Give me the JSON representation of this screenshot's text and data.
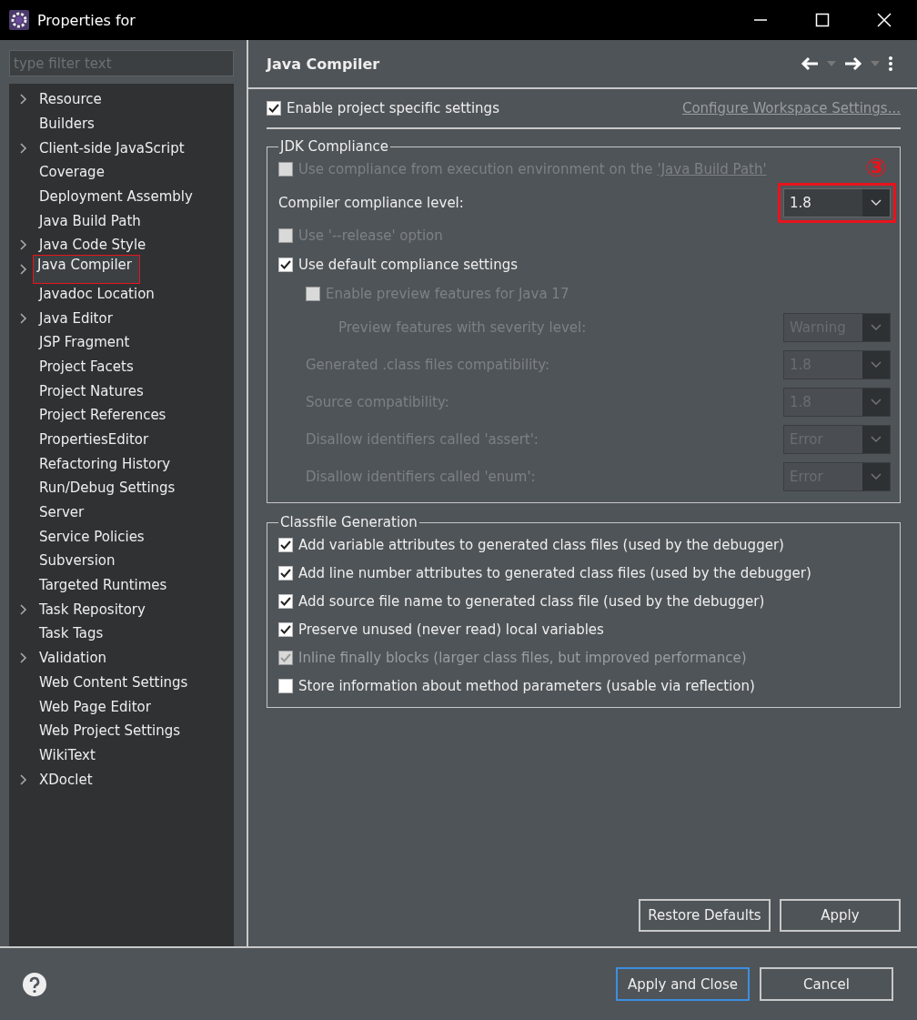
{
  "window": {
    "title": "Properties for"
  },
  "filter": {
    "placeholder": "type filter text"
  },
  "tree": [
    {
      "label": "Resource",
      "expandable": true,
      "selected": false
    },
    {
      "label": "Builders",
      "expandable": false,
      "selected": false
    },
    {
      "label": "Client-side JavaScript",
      "expandable": true,
      "selected": false
    },
    {
      "label": "Coverage",
      "expandable": false,
      "selected": false
    },
    {
      "label": "Deployment Assembly",
      "expandable": false,
      "selected": false
    },
    {
      "label": "Java Build Path",
      "expandable": false,
      "selected": false
    },
    {
      "label": "Java Code Style",
      "expandable": true,
      "selected": false
    },
    {
      "label": "Java Compiler",
      "expandable": true,
      "selected": true
    },
    {
      "label": "Javadoc Location",
      "expandable": false,
      "selected": false
    },
    {
      "label": "Java Editor",
      "expandable": true,
      "selected": false
    },
    {
      "label": "JSP Fragment",
      "expandable": false,
      "selected": false
    },
    {
      "label": "Project Facets",
      "expandable": false,
      "selected": false
    },
    {
      "label": "Project Natures",
      "expandable": false,
      "selected": false
    },
    {
      "label": "Project References",
      "expandable": false,
      "selected": false
    },
    {
      "label": "PropertiesEditor",
      "expandable": false,
      "selected": false
    },
    {
      "label": "Refactoring History",
      "expandable": false,
      "selected": false
    },
    {
      "label": "Run/Debug Settings",
      "expandable": false,
      "selected": false
    },
    {
      "label": "Server",
      "expandable": false,
      "selected": false
    },
    {
      "label": "Service Policies",
      "expandable": false,
      "selected": false
    },
    {
      "label": "Subversion",
      "expandable": false,
      "selected": false
    },
    {
      "label": "Targeted Runtimes",
      "expandable": false,
      "selected": false
    },
    {
      "label": "Task Repository",
      "expandable": true,
      "selected": false
    },
    {
      "label": "Task Tags",
      "expandable": false,
      "selected": false
    },
    {
      "label": "Validation",
      "expandable": true,
      "selected": false
    },
    {
      "label": "Web Content Settings",
      "expandable": false,
      "selected": false
    },
    {
      "label": "Web Page Editor",
      "expandable": false,
      "selected": false
    },
    {
      "label": "Web Project Settings",
      "expandable": false,
      "selected": false
    },
    {
      "label": "WikiText",
      "expandable": false,
      "selected": false
    },
    {
      "label": "XDoclet",
      "expandable": true,
      "selected": false
    }
  ],
  "page": {
    "title": "Java Compiler"
  },
  "project_specific": {
    "label": "Enable project specific settings",
    "checked": true
  },
  "workspace_link": {
    "label": "Configure Workspace Settings...",
    "disabled": true
  },
  "jdk": {
    "title": "JDK Compliance",
    "annotation": "③",
    "rows": [
      {
        "kind": "checkbox",
        "label": "Use compliance from execution environment on the ",
        "link": "'Java Build Path'",
        "checked": false,
        "disabled": true
      },
      {
        "kind": "select",
        "label": "Compiler compliance level:",
        "value": "1.8",
        "disabled": false,
        "highlighted": true
      },
      {
        "kind": "checkbox",
        "label": "Use '--release' option",
        "checked": false,
        "disabled": true
      },
      {
        "kind": "checkbox",
        "label": "Use default compliance settings",
        "checked": true,
        "disabled": false,
        "children": [
          {
            "kind": "checkbox",
            "label": "Enable preview features for Java 17",
            "checked": false,
            "disabled": true,
            "children": [
              {
                "kind": "select",
                "label": "Preview features with severity level:",
                "value": "Warning",
                "disabled": true,
                "highlighted": false
              }
            ]
          },
          {
            "kind": "select",
            "label": "Generated .class files compatibility:",
            "value": "1.8",
            "disabled": true,
            "highlighted": false
          },
          {
            "kind": "select",
            "label": "Source compatibility:",
            "value": "1.8",
            "disabled": true,
            "highlighted": false
          },
          {
            "kind": "select",
            "label": "Disallow identifiers called 'assert':",
            "value": "Error",
            "disabled": true,
            "highlighted": false
          },
          {
            "kind": "select",
            "label": "Disallow identifiers called 'enum':",
            "value": "Error",
            "disabled": true,
            "highlighted": false
          }
        ]
      }
    ]
  },
  "classfile": {
    "title": "Classfile Generation",
    "options": [
      {
        "label": "Add variable attributes to generated class files (used by the debugger)",
        "checked": true,
        "disabled": false
      },
      {
        "label": "Add line number attributes to generated class files (used by the debugger)",
        "checked": true,
        "disabled": false
      },
      {
        "label": "Add source file name to generated class file (used by the debugger)",
        "checked": true,
        "disabled": false
      },
      {
        "label": "Preserve unused (never read) local variables",
        "checked": true,
        "disabled": false
      },
      {
        "label": "Inline finally blocks (larger class files, but improved performance)",
        "checked": true,
        "disabled": true
      },
      {
        "label": "Store information about method parameters (usable via reflection)",
        "checked": false,
        "disabled": false
      }
    ]
  },
  "page_buttons": [
    {
      "label": "Restore Defaults",
      "default": false
    },
    {
      "label": "Apply",
      "default": false
    }
  ],
  "dialog_buttons": [
    {
      "label": "Apply and Close",
      "default": true
    },
    {
      "label": "Cancel",
      "default": false
    }
  ]
}
